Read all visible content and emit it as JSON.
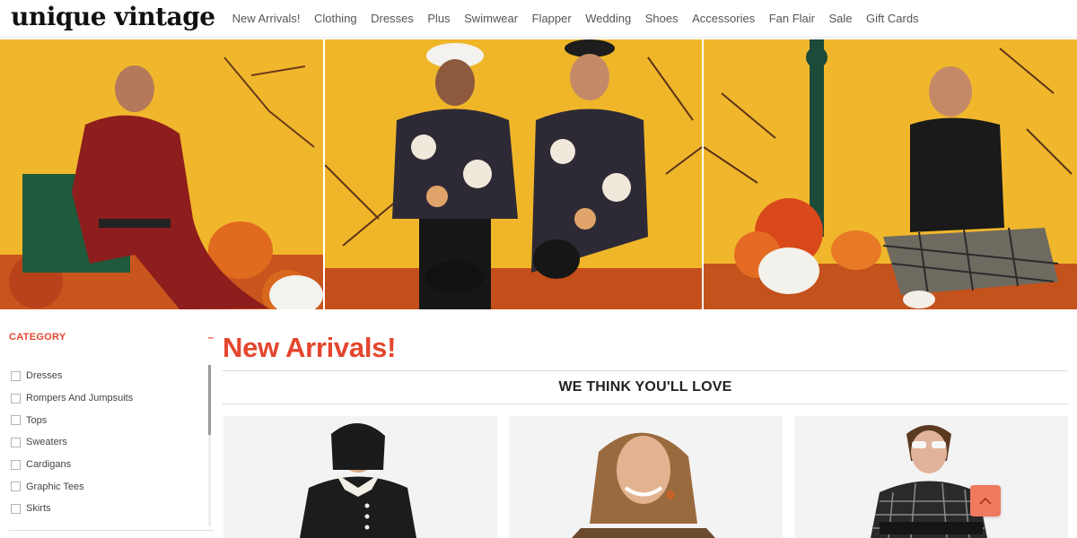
{
  "header": {
    "logo": "unique vintage",
    "nav": [
      "New Arrivals!",
      "Clothing",
      "Dresses",
      "Plus",
      "Swimwear",
      "Flapper",
      "Wedding",
      "Shoes",
      "Accessories",
      "Fan Flair",
      "Sale",
      "Gift Cards"
    ]
  },
  "sidebar": {
    "title": "CATEGORY",
    "collapse": "–",
    "items": [
      "Dresses",
      "Rompers And Jumpsuits",
      "Tops",
      "Sweaters",
      "Cardigans",
      "Graphic Tees",
      "Skirts"
    ]
  },
  "main": {
    "title": "New Arrivals!",
    "section": "WE THINK YOU'LL LOVE"
  },
  "colors": {
    "accent": "#e4462e",
    "hero_background": "#f0b62a",
    "back_to_top": "#f07a5e"
  },
  "icons": {
    "back_to_top": "chevron-up-icon",
    "collapse": "minus-icon"
  }
}
